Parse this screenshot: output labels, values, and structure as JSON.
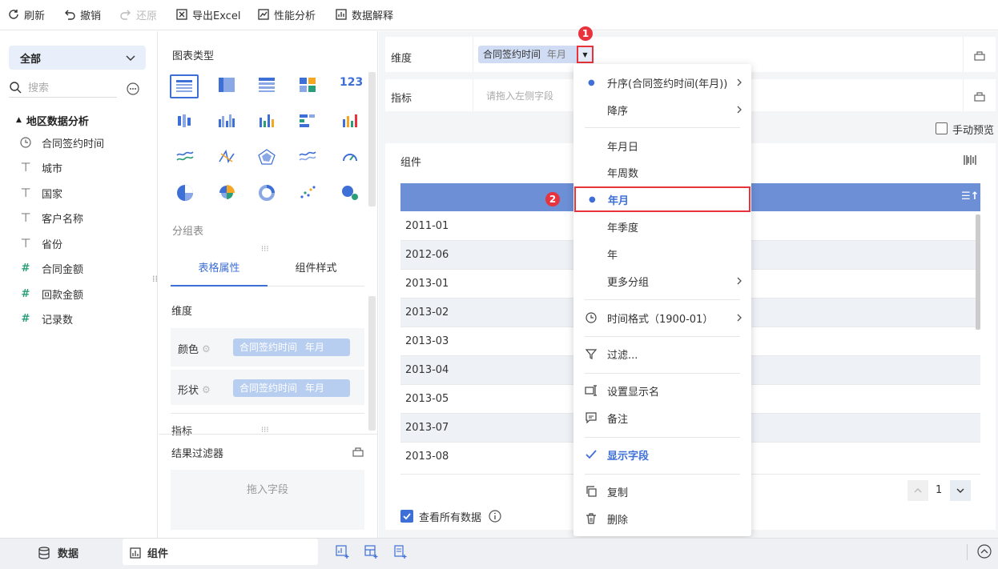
{
  "toolbar": {
    "refresh": "刷新",
    "undo": "撤销",
    "redo": "还原",
    "export_excel": "导出Excel",
    "perf": "性能分析",
    "explain": "数据解释"
  },
  "left": {
    "all_label": "全部",
    "search_placeholder": "搜索",
    "dataset": "地区数据分析",
    "fields": [
      {
        "label": "合同签约时间",
        "icon": "clock-icon"
      },
      {
        "label": "城市",
        "icon": "text-field-icon"
      },
      {
        "label": "国家",
        "icon": "text-field-icon"
      },
      {
        "label": "客户名称",
        "icon": "text-field-icon"
      },
      {
        "label": "省份",
        "icon": "text-field-icon"
      },
      {
        "label": "合同金额",
        "icon": "number-field-icon"
      },
      {
        "label": "回款金额",
        "icon": "number-field-icon"
      },
      {
        "label": "记录数",
        "icon": "number-field-icon"
      }
    ]
  },
  "middle": {
    "chart_type_title": "图表类型",
    "group_table": "分组表",
    "tab_props": "表格属性",
    "tab_style": "组件样式",
    "dimension": "维度",
    "color_label": "颜色",
    "shape_label": "形状",
    "pill_field": "合同签约时间",
    "pill_suffix": "年月",
    "indicator": "指标",
    "result_filter": "结果过滤器",
    "drag_field": "拖入字段"
  },
  "right": {
    "dimension_label": "维度",
    "dim_field": "合同签约时间",
    "dim_suffix": "年月",
    "indicator_label": "指标",
    "indicator_placeholder": "请拖入左侧字段",
    "manual_preview": "手动预览",
    "widget_title": "组件",
    "rows": [
      "2011-01",
      "2012-06",
      "2013-01",
      "2013-02",
      "2013-03",
      "2013-04",
      "2013-05",
      "2013-07",
      "2013-08"
    ],
    "page_num": "1",
    "view_all": "查看所有数据"
  },
  "menu": {
    "asc": "升序(合同签约时间(年月))",
    "desc": "降序",
    "ymd": "年月日",
    "yweek": "年周数",
    "ym": "年月",
    "yq": "年季度",
    "y": "年",
    "more_group": "更多分组",
    "time_format": "时间格式（1900-01）",
    "filter": "过滤...",
    "set_name": "设置显示名",
    "note": "备注",
    "show_field": "显示字段",
    "copy": "复制",
    "delete": "删除"
  },
  "badges": {
    "b1": "1",
    "b2": "2"
  },
  "bottom": {
    "data_tab": "数据",
    "widget_tab": "组件"
  },
  "colors": {
    "accent": "#3d6fd6",
    "header": "#6c8fd6",
    "pill": "#b8cef0",
    "badge": "#e8323c"
  }
}
